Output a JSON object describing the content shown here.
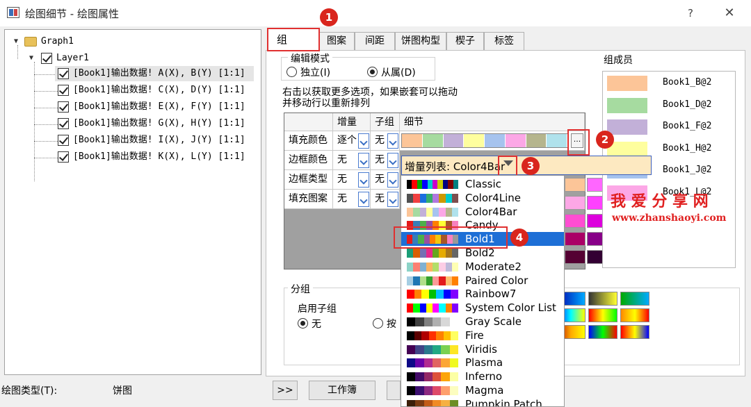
{
  "window": {
    "title": "绘图细节 - 绘图属性",
    "help": "?",
    "close": "✕"
  },
  "tree": {
    "graph": "Graph1",
    "layer": "Layer1",
    "items": [
      "[Book1]输出数据! A(X), B(Y) [1:1]",
      "[Book1]输出数据! C(X), D(Y) [1:1]",
      "[Book1]输出数据! E(X), F(Y) [1:1]",
      "[Book1]输出数据! G(X), H(Y) [1:1]",
      "[Book1]输出数据! I(X), J(Y) [1:1]",
      "[Book1]输出数据! K(X), L(Y) [1:1]"
    ]
  },
  "tabs": [
    "组",
    "图案",
    "间距",
    "饼图构型",
    "楔子",
    "标签"
  ],
  "edit_mode": {
    "title": "编辑模式",
    "option_independent": "独立(I)",
    "option_dependent": "从属(D)"
  },
  "hint_line1": "右击以获取更多选项，如果嵌套可以拖动",
  "hint_line2": "并移动行以重新排列",
  "grid": {
    "headers": [
      "增量",
      "子组",
      "细节"
    ],
    "rows": [
      {
        "label": "填充颜色",
        "increment": "逐个",
        "subgroup": "无"
      },
      {
        "label": "边框颜色",
        "increment": "无",
        "subgroup": "无"
      },
      {
        "label": "边框类型",
        "increment": "无",
        "subgroup": "无"
      },
      {
        "label": "填充图案",
        "increment": "无",
        "subgroup": "无"
      }
    ],
    "ellipsis": "..."
  },
  "members": {
    "title": "组成员",
    "items": [
      {
        "name": "Book1_B@2",
        "color": "#fcc598"
      },
      {
        "name": "Book1_D@2",
        "color": "#a6dba0"
      },
      {
        "name": "Book1_F@2",
        "color": "#c2b0d8"
      },
      {
        "name": "Book1_H@2",
        "color": "#fefe9e"
      },
      {
        "name": "Book1_J@2",
        "color": "#a6c3ee"
      },
      {
        "name": "Book1_L@2",
        "color": "#fca7e6"
      }
    ]
  },
  "increment_combo": "增量列表: Color4Bar",
  "dropdown": {
    "items": [
      {
        "name": "Classic",
        "colors": [
          "#000000",
          "#ff0000",
          "#00aa00",
          "#0000ff",
          "#00cccc",
          "#cc00cc",
          "#cccc00",
          "#000080",
          "#800000",
          "#008080"
        ]
      },
      {
        "name": "Color4Line",
        "colors": [
          "#515151",
          "#f14040",
          "#1a6fdf",
          "#37ad6b",
          "#b177de",
          "#cc9900",
          "#00cbcc",
          "#7d4e4e"
        ]
      },
      {
        "name": "Color4Bar",
        "colors": [
          "#fcc598",
          "#a6dba0",
          "#c2b0d8",
          "#fefe9e",
          "#a6c3ee",
          "#fca7e6",
          "#b5b58d",
          "#b0e2ec"
        ]
      },
      {
        "name": "Candy",
        "colors": [
          "#e41a1c",
          "#377eb8",
          "#4daf4a",
          "#984ea3",
          "#ff7f00",
          "#ffff33",
          "#a65628",
          "#f781bf"
        ]
      },
      {
        "name": "Bold1",
        "colors": [
          "#e41a1c",
          "#377eb8",
          "#4daf4a",
          "#984ea3",
          "#ff7f00",
          "#f2c80f",
          "#a65628",
          "#f781bf",
          "#999999"
        ]
      },
      {
        "name": "Bold2",
        "colors": [
          "#1b9e77",
          "#d95f02",
          "#7570b3",
          "#e7298a",
          "#66a61e",
          "#e6ab02",
          "#a6761d",
          "#666666"
        ]
      },
      {
        "name": "Moderate2",
        "colors": [
          "#8dd3c7",
          "#fb8072",
          "#80b1d3",
          "#fdb462",
          "#b3de69",
          "#fccde5",
          "#bebada",
          "#ffffb3"
        ]
      },
      {
        "name": "Paired Color",
        "colors": [
          "#a6cee3",
          "#1f78b4",
          "#b2df8a",
          "#33a02c",
          "#fb9a99",
          "#e31a1c",
          "#fdbf6f",
          "#ff7f00"
        ]
      },
      {
        "name": "Rainbow7",
        "colors": [
          "#ff0000",
          "#ff8000",
          "#ffff00",
          "#00c000",
          "#00c0ff",
          "#0000ff",
          "#8000ff"
        ]
      },
      {
        "name": "System Color List",
        "colors": [
          "#ff0000",
          "#00ff00",
          "#0000ff",
          "#ffff00",
          "#ff00ff",
          "#00ffff",
          "#ff8000",
          "#8000ff"
        ]
      },
      {
        "name": "Gray Scale",
        "colors": [
          "#000000",
          "#404040",
          "#808080",
          "#b0b0b0",
          "#d8d8d8",
          "#ffffff"
        ]
      },
      {
        "name": "Fire",
        "colors": [
          "#000000",
          "#5a0000",
          "#b00000",
          "#ff3000",
          "#ff8000",
          "#ffc000",
          "#ffff60"
        ]
      },
      {
        "name": "Viridis",
        "colors": [
          "#440154",
          "#414487",
          "#2a788e",
          "#22a884",
          "#7ad151",
          "#fde725"
        ]
      },
      {
        "name": "Plasma",
        "colors": [
          "#0d0887",
          "#6a00a8",
          "#b12a90",
          "#e16462",
          "#fca636",
          "#f0f921"
        ]
      },
      {
        "name": "Inferno",
        "colors": [
          "#000004",
          "#420a68",
          "#932667",
          "#dd513a",
          "#fca50a",
          "#fcffa4"
        ]
      },
      {
        "name": "Magma",
        "colors": [
          "#000004",
          "#3b0f70",
          "#8c2981",
          "#de4968",
          "#fe9f6d",
          "#fcfdbf"
        ]
      },
      {
        "name": "Pumpkin Patch",
        "colors": [
          "#3b1e08",
          "#7a3a10",
          "#c25b16",
          "#f08a24",
          "#f5b041",
          "#6b8e23"
        ]
      }
    ]
  },
  "group": {
    "title": "分组",
    "enable_subgroup": "启用子组",
    "option_none": "无",
    "option_by": "按"
  },
  "footer": {
    "plot_type_label": "绘图类型(T):",
    "plot_type_value": "饼图",
    "expand_button": ">>",
    "workbook_button": "工作簿"
  },
  "badges": [
    "1",
    "2",
    "3",
    "4"
  ],
  "watermark": {
    "title": "我 爱 分 享 网",
    "url": "www.zhanshaoyi.com"
  },
  "detail_colors": [
    "#fcc598",
    "#a6dba0",
    "#c2b0d8",
    "#fefe9e",
    "#a6c3ee",
    "#fca7e6",
    "#b5b58d",
    "#b0e2ec"
  ],
  "swatch_rows": [
    [
      "#fcc598",
      "#ff66ff",
      "#dfdfa8",
      "#b0e2ec"
    ],
    [
      "#fca7e6",
      "#ff40ff",
      "#c8c890",
      "#a0d8e8"
    ],
    [
      "#ff4dd2",
      "#dd00dd",
      "#b8b890",
      "#a8e0ee"
    ],
    [
      "#aa0066",
      "#880088",
      "#8a8a6a",
      "#3a8f9a"
    ],
    [
      "#550033",
      "#330033",
      "#555533",
      "#2a7f8a"
    ]
  ],
  "gradient_rows": [
    [
      "linear-gradient(90deg,#0000aa,#00aaff)",
      "linear-gradient(90deg,#333,#ff3)",
      "linear-gradient(90deg,#0a0,#0af)"
    ],
    [
      "linear-gradient(90deg,#00f,#0ff,#ff0)",
      "linear-gradient(90deg,#f00,#ff0,#0f0)",
      "linear-gradient(90deg,#f80,#ff0,#f00)"
    ],
    [
      "linear-gradient(90deg,#a00,#fa0,#ff0)",
      "linear-gradient(90deg,#00f,#0f0,#f00)",
      "linear-gradient(90deg,#f00,#ff0,#00f)"
    ]
  ]
}
